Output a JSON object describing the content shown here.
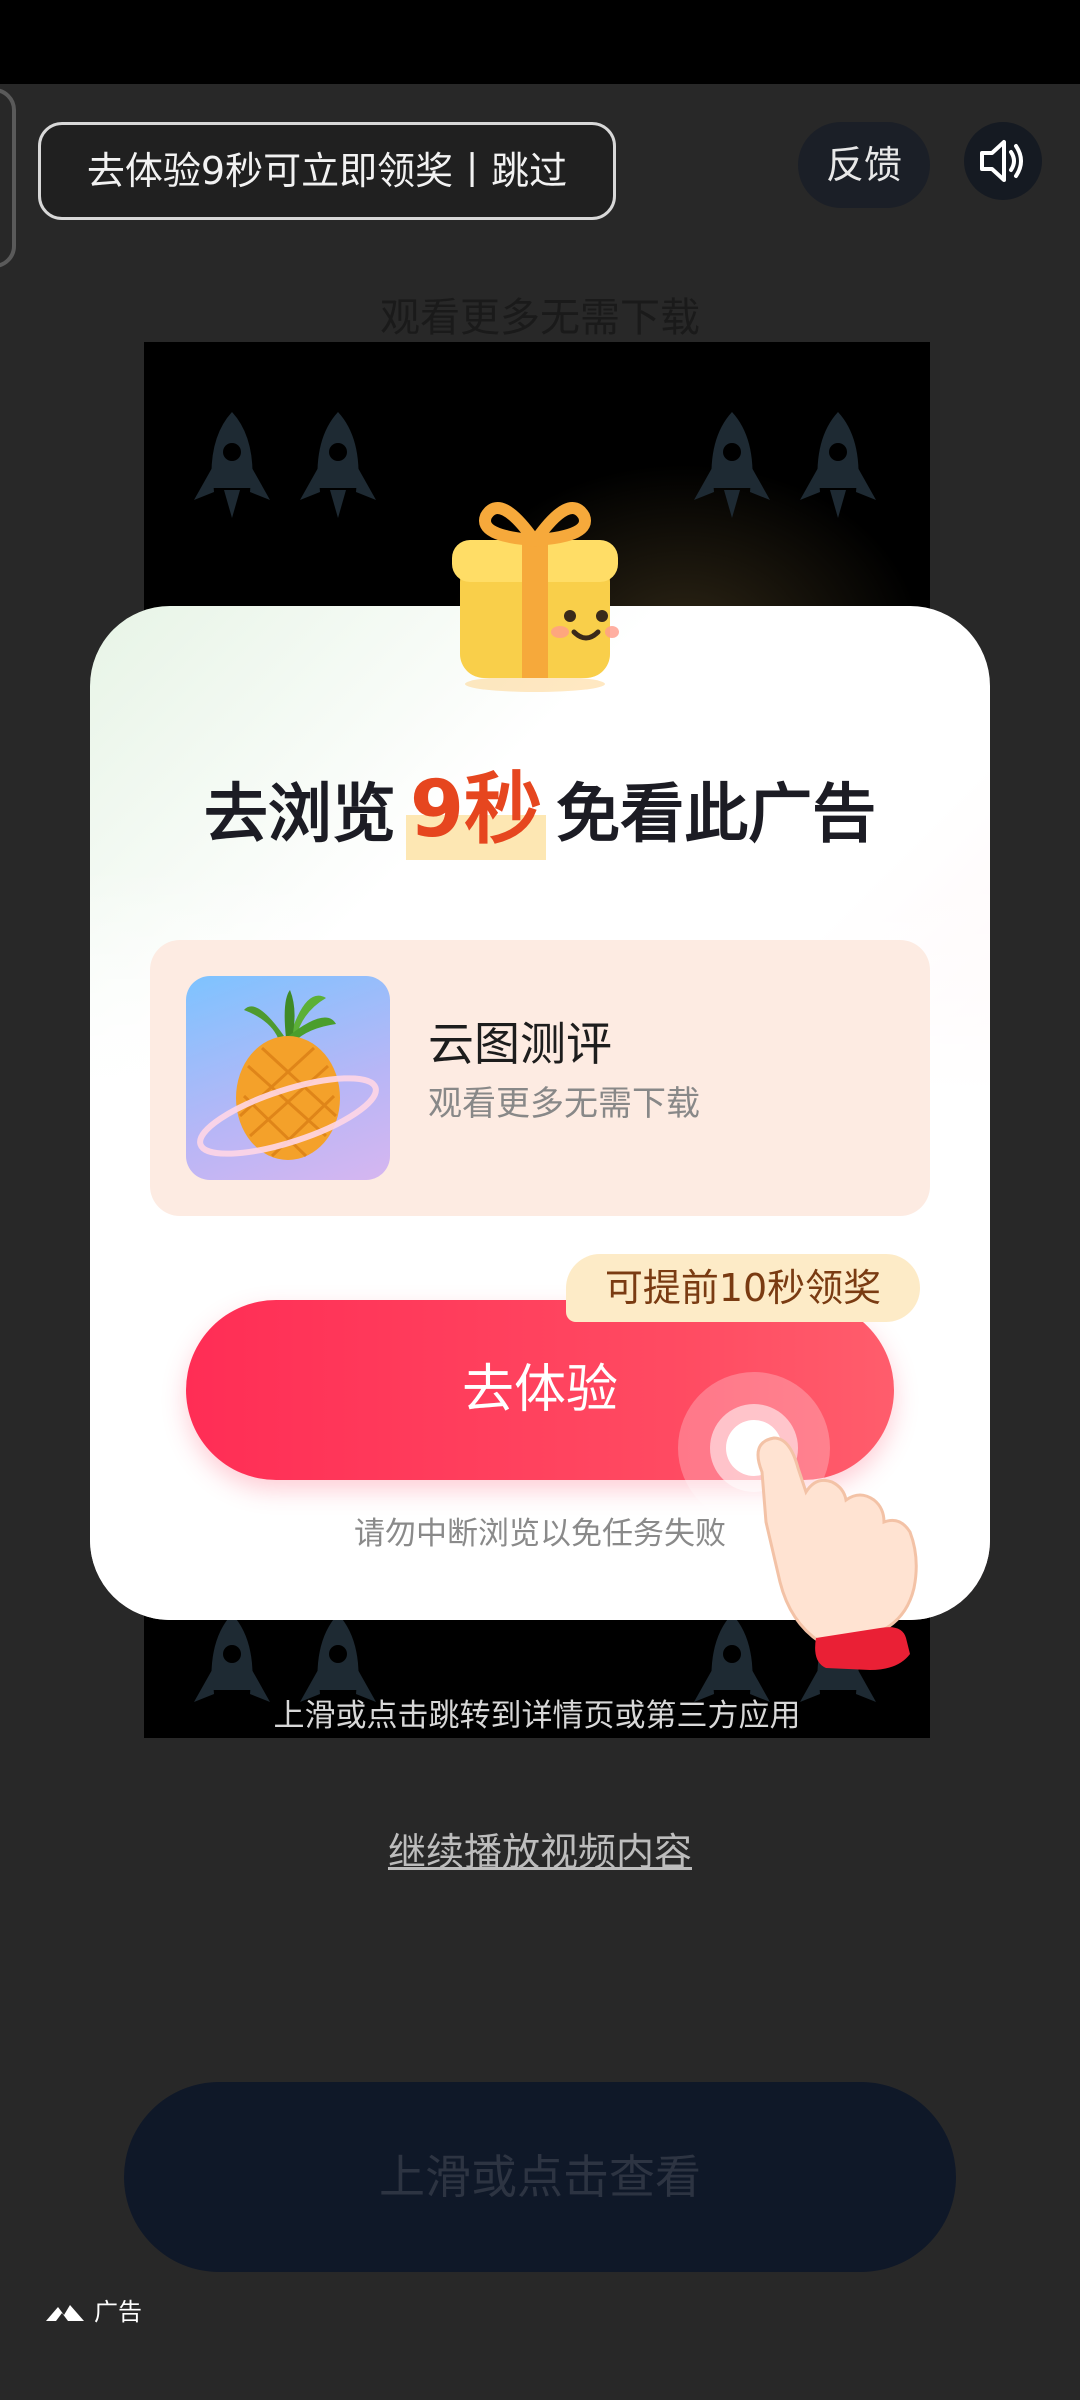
{
  "top_bar": {
    "skip_text": "去体验9秒可立即领奖丨跳过",
    "feedback_label": "反馈",
    "sound_icon": "speaker-icon"
  },
  "video": {
    "caption": "观看更多无需下载",
    "bottom_hint": "上滑或点击跳转到详情页或第三方应用"
  },
  "card": {
    "title_prefix": "去浏览",
    "title_number": "9秒",
    "title_suffix": "免看此广告",
    "app_name": "云图测评",
    "app_subtitle": "观看更多无需下载",
    "badge_text": "可提前10秒领奖",
    "cta_label": "去体验",
    "warning": "请勿中断浏览以免任务失败"
  },
  "footer": {
    "continue_label": "继续播放视频内容",
    "swipe_label": "上滑或点击查看",
    "ad_label": "广告"
  },
  "colors": {
    "accent": "#ff2d55",
    "highlight_number": "#e6461f",
    "badge_bg": "#fdebc7"
  }
}
